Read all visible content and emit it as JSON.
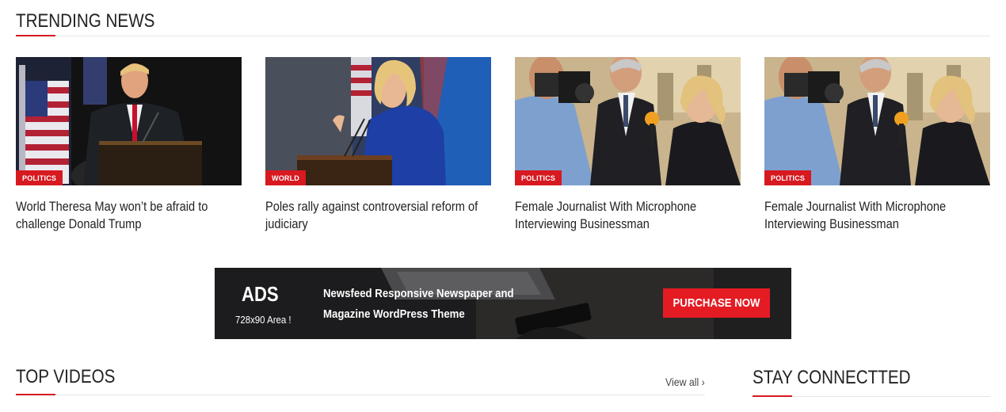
{
  "trending": {
    "title": "TRENDING NEWS",
    "cards": [
      {
        "category": "POLITICS",
        "headline": "World Theresa May won’t be afraid to challenge Donald Trump",
        "image": "speaker-at-podium-with-flags"
      },
      {
        "category": "WORLD",
        "headline": "Poles rally against controversial reform of judiciary",
        "image": "woman-speaking-at-podium"
      },
      {
        "category": "POLITICS",
        "headline": "Female Journalist With Microphone Interviewing Businessman",
        "image": "journalist-interview"
      },
      {
        "category": "POLITICS",
        "headline": "Female Journalist With Microphone Interviewing Businessman",
        "image": "journalist-interview"
      }
    ]
  },
  "ad": {
    "label": "ADS",
    "size_text": "728x90 Area !",
    "text": "Newsfeed Responsive Newspaper and Magazine WordPress Theme",
    "button_label": "PURCHASE NOW"
  },
  "top_videos": {
    "title": "TOP VIDEOS",
    "view_all": "View all ›"
  },
  "stay_connected": {
    "title": "STAY CONNECTTED"
  },
  "colors": {
    "accent": "#d71920",
    "rule": "#e6e6e6",
    "text": "#222222"
  }
}
